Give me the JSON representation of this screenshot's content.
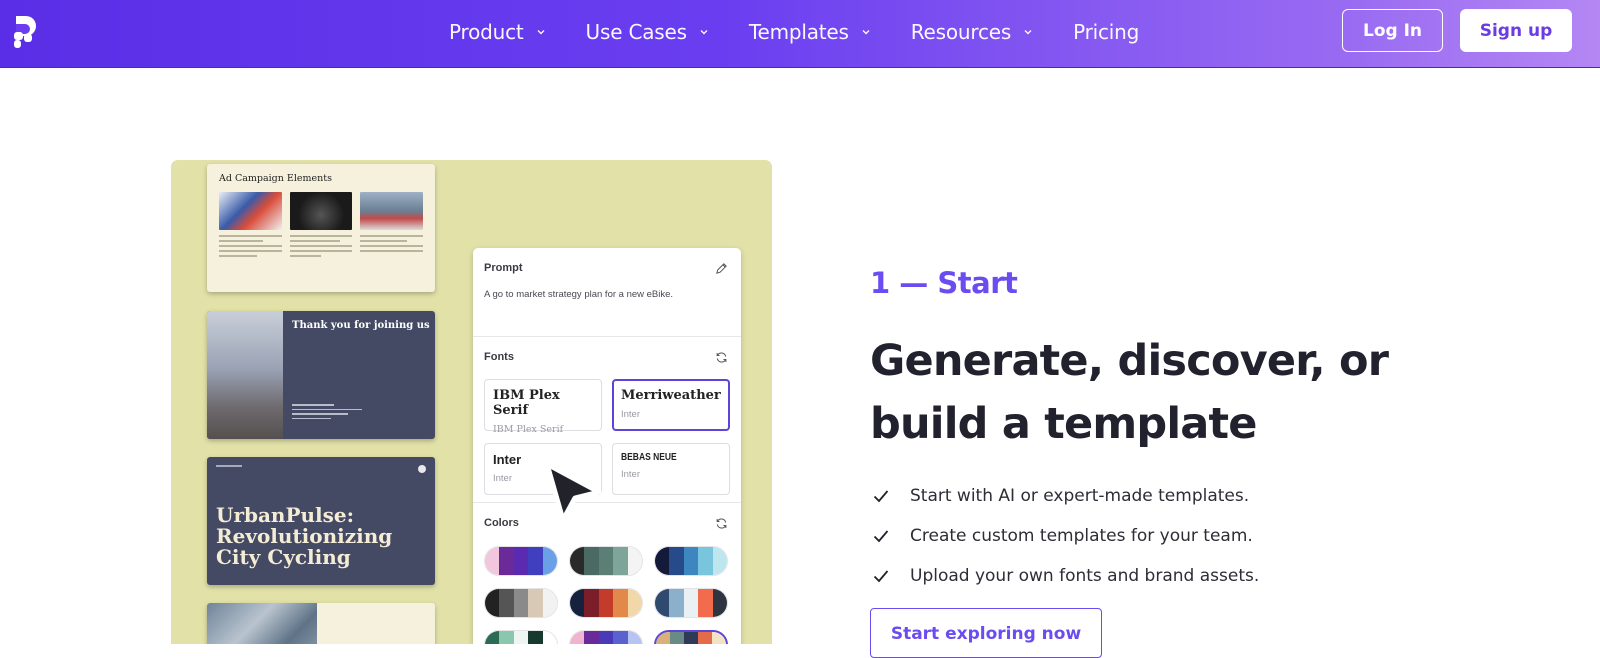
{
  "nav": {
    "items": [
      {
        "label": "Product",
        "has_menu": true
      },
      {
        "label": "Use Cases",
        "has_menu": true
      },
      {
        "label": "Templates",
        "has_menu": true
      },
      {
        "label": "Resources",
        "has_menu": true
      },
      {
        "label": "Pricing",
        "has_menu": false
      }
    ],
    "login_label": "Log In",
    "signup_label": "Sign up",
    "gradient": [
      "#5a2ee6",
      "#b487f4"
    ]
  },
  "illustration": {
    "slides": {
      "ad_campaign_title": "Ad Campaign Elements",
      "thanks_title": "Thank you for joining us",
      "urbanpulse_title": "UrbanPulse: Revolutionizing City Cycling"
    },
    "panel": {
      "prompt_label": "Prompt",
      "prompt_text": "A go to market strategy plan for a new eBike.",
      "fonts_label": "Fonts",
      "fonts": [
        {
          "name": "IBM Plex Serif",
          "sub": "IBM Plex Serif",
          "selected": false
        },
        {
          "name": "Merriweather",
          "sub": "Inter",
          "selected": true
        },
        {
          "name": "Inter",
          "sub": "Inter",
          "selected": false
        },
        {
          "name": "BEBAS NEUE",
          "sub": "Inter",
          "selected": false
        }
      ],
      "colors_label": "Colors",
      "palettes": [
        [
          "#f2c6dc",
          "#6a2a9a",
          "#5a2ab0",
          "#3f3fc0",
          "#6aa0e6"
        ],
        [
          "#2a2a2a",
          "#4b6a64",
          "#5b7f74",
          "#7fa59a",
          "#f4f4f4"
        ],
        [
          "#131a3a",
          "#264a8a",
          "#3d86c0",
          "#7ac5de",
          "#bde6ee"
        ],
        [
          "#222222",
          "#555555",
          "#8a8a8a",
          "#d7c9b5",
          "#f2f2f2"
        ],
        [
          "#16213e",
          "#7b1e2a",
          "#c23b2b",
          "#e3884b",
          "#f2d8a8"
        ],
        [
          "#2f4a6e",
          "#8ab0cc",
          "#e9f1f4",
          "#f26b4c",
          "#2e3440"
        ],
        [
          "#2b6b54",
          "#8bc7ae",
          "#eef6f2",
          "#173a2f",
          "#ffffff"
        ],
        [
          "#f0b4d0",
          "#6a2a9a",
          "#4a3ab8",
          "#5a62d0",
          "#b8c4f0"
        ],
        [
          "#d8b07a",
          "#6a8a86",
          "#2f3a58",
          "#e36b4a",
          "#f2e2c6"
        ]
      ]
    }
  },
  "section": {
    "step": "1 — Start",
    "headline": "Generate, discover, or build a template",
    "features": [
      "Start with AI or expert-made templates.",
      "Create custom templates for your team.",
      "Upload your own fonts and brand assets."
    ],
    "cta": "Start exploring now",
    "accent": "#6a4cf0"
  }
}
